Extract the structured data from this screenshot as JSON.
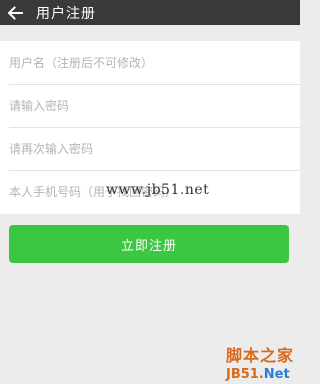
{
  "titlebar": {
    "title": "用户注册",
    "back_icon": "arrow-left-icon"
  },
  "form": {
    "username_placeholder": "用户名（注册后不可修改）",
    "password_placeholder": "请输入密码",
    "confirm_password_placeholder": "请再次输入密码",
    "phone_placeholder": "本人手机号码（用于找回密码）"
  },
  "register_button": {
    "label": "立即注册"
  },
  "watermark": {
    "url_prefix": "www",
    "url_dot1": ".",
    "url_mid": "jb51",
    "url_dot2": ".",
    "url_suffix": "net",
    "logo_top": "脚本之家",
    "logo_bottom_main": "JB51.",
    "logo_bottom_net": "Net"
  },
  "colors": {
    "titlebar_bg": "#3a3a3a",
    "accent_green": "#3cc743",
    "page_bg": "#ececec",
    "placeholder": "#b4b4b4"
  }
}
